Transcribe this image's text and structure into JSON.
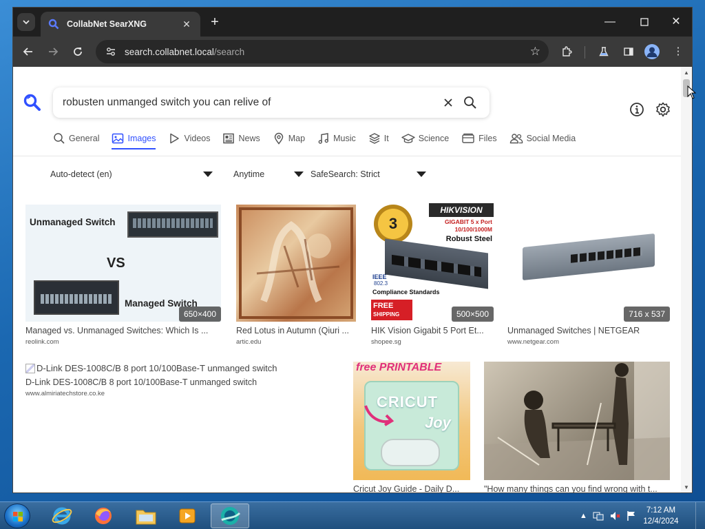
{
  "browser": {
    "tab_title": "CollabNet SearXNG",
    "url_host": "search.collabnet.local",
    "url_path": "/search"
  },
  "search": {
    "query": "robusten unmanged switch you can relive of"
  },
  "categories": [
    {
      "label": "General",
      "icon": "search-icon"
    },
    {
      "label": "Images",
      "icon": "image-icon",
      "active": true
    },
    {
      "label": "Videos",
      "icon": "play-icon"
    },
    {
      "label": "News",
      "icon": "newspaper-icon"
    },
    {
      "label": "Map",
      "icon": "map-pin-icon"
    },
    {
      "label": "Music",
      "icon": "music-note-icon"
    },
    {
      "label": "It",
      "icon": "layers-icon"
    },
    {
      "label": "Science",
      "icon": "graduation-cap-icon"
    },
    {
      "label": "Files",
      "icon": "files-icon"
    },
    {
      "label": "Social Media",
      "icon": "people-icon"
    }
  ],
  "filters": {
    "language": "Auto-detect (en)",
    "time": "Anytime",
    "safesearch": "SafeSearch: Strict"
  },
  "results": [
    {
      "title": "Managed vs. Unmanaged Switches: Which Is ...",
      "host": "reolink.com",
      "size": "650×400",
      "thumb_text": {
        "top": "Unmanaged Switch",
        "mid": "VS",
        "bottom": "Managed Switch"
      }
    },
    {
      "title": "Red Lotus in Autumn (Qiuri ...",
      "host": "artic.edu"
    },
    {
      "title": "HIK Vision Gigabit 5 Port Et...",
      "host": "shopee.sg",
      "size": "500×500",
      "thumb_text": {
        "brand": "HIKVISION",
        "line1": "GIGABIT 5 x Port",
        "line2": "10/100/1000M",
        "line3": "Robust Steel",
        "warranty": "3",
        "ieee": "IEEE",
        "std": "802.3",
        "compliance": "Compliance Standards",
        "free": "FREE",
        "shipping": "SHIPPING"
      }
    },
    {
      "title": "Unmanaged Switches | NETGEAR",
      "host": "www.netgear.com",
      "size": "716 x 537"
    },
    {
      "title": "D-Link DES-1008C/B 8 port 10/100Base-T unmanged switch",
      "alt": "D-Link DES-1008C/B 8 port 10/100Base-T unmanged switch",
      "host": "www.almiriatechstore.co.ke"
    },
    {
      "title": "Cricut Joy Guide - Daily D...",
      "thumb_text": {
        "top": "free PRINTABLE",
        "brand": "CRICUT",
        "sub": "Joy"
      }
    },
    {
      "title": "\"How many things can you find wrong with t..."
    }
  ],
  "taskbar": {
    "time": "7:12 AM",
    "date": "12/4/2024"
  },
  "colors": {
    "accent": "#3050ff",
    "chrome_dark": "#1f1f1f",
    "chrome_toolbar": "#3a3a3a",
    "desktop_blue": "#1f6fb8"
  }
}
